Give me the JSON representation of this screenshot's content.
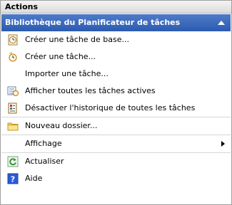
{
  "pane": {
    "title": "Actions",
    "section": {
      "title": "Bibliothèque du Planificateur de tâches",
      "items": [
        {
          "label": "Créer une tâche de base...",
          "icon": "basic-task-icon"
        },
        {
          "label": "Créer une tâche...",
          "icon": "create-task-icon"
        },
        {
          "label": "Importer une tâche...",
          "icon": ""
        },
        {
          "label": "Afficher toutes les tâches actives",
          "icon": "active-tasks-icon"
        },
        {
          "label": "Désactiver l'historique de toutes les tâches",
          "icon": "history-icon"
        },
        {
          "label": "Nouveau dossier...",
          "icon": "folder-icon"
        },
        {
          "label": "Affichage",
          "icon": "",
          "submenu": true
        },
        {
          "label": "Actualiser",
          "icon": "refresh-icon"
        },
        {
          "label": "Aide",
          "icon": "help-icon"
        }
      ]
    }
  },
  "colors": {
    "section_header": "#2c5bb0",
    "section_text": "#ffffff"
  }
}
